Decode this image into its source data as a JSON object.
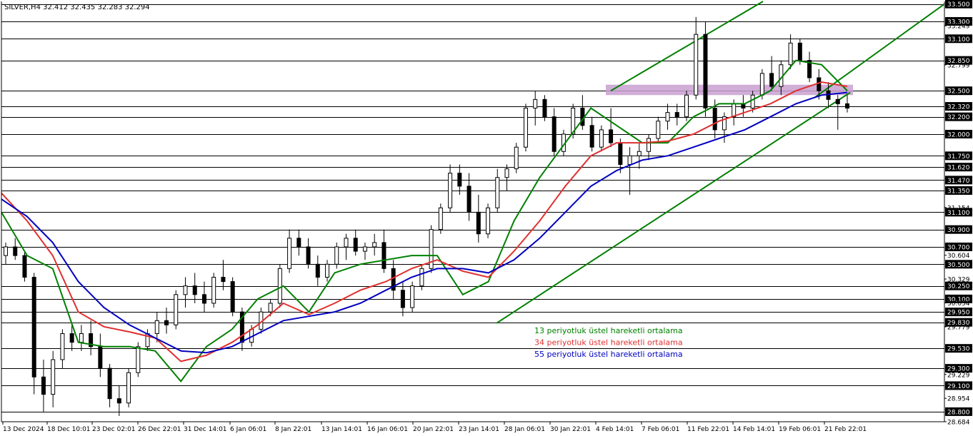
{
  "chart_data": {
    "type": "candlestick",
    "symbol_header": "SILVER,H4  32.412 32.435 32.283 32.294",
    "ylim": [
      28.684,
      33.53
    ],
    "level_lines": [
      33.5,
      33.3,
      33.1,
      32.85,
      32.5,
      32.32,
      32.2,
      32.0,
      31.75,
      31.62,
      31.47,
      31.35,
      31.1,
      30.9,
      30.7,
      30.5,
      30.25,
      30.1,
      29.95,
      29.83,
      29.53,
      29.3,
      29.1,
      28.8
    ],
    "y_tick_labels_boxed": [
      "33.500",
      "33.300",
      "33.100",
      "32.850",
      "32.500",
      "32.320",
      "32.200",
      "32.000",
      "31.750",
      "31.620",
      "31.470",
      "31.350",
      "31.100",
      "30.900",
      "30.700",
      "30.500",
      "30.250",
      "30.100",
      "29.950",
      "29.830",
      "29.530",
      "29.300",
      "29.100",
      "28.800"
    ],
    "y_tick_labels_plain": [
      {
        "value": 33.249,
        "text": "33.249"
      },
      {
        "value": 32.799,
        "text": "32.799"
      },
      {
        "value": 31.154,
        "text": "31.154"
      },
      {
        "value": 30.604,
        "text": "30.604"
      },
      {
        "value": 30.329,
        "text": "30.329"
      },
      {
        "value": 30.054,
        "text": "30.054"
      },
      {
        "value": 29.779,
        "text": "29.779"
      },
      {
        "value": 29.229,
        "text": "29.229"
      },
      {
        "value": 28.954,
        "text": "28.954"
      },
      {
        "value": 28.684,
        "text": "28.684"
      }
    ],
    "x_tick_labels": [
      "13 Dec 2024",
      "18 Dec 10:01",
      "23 Dec 02:01",
      "26 Dec 22:01",
      "31 Dec 14:01",
      "6 Jan 06:01",
      "8 Jan 22:01",
      "13 Jan 14:01",
      "16 Jan 06:01",
      "20 Jan 22:01",
      "23 Jan 14:01",
      "28 Jan 06:01",
      "30 Jan 22:01",
      "4 Feb 14:01",
      "7 Feb 06:01",
      "11 Feb 22:01",
      "14 Feb 14:01",
      "19 Feb 06:01",
      "21 Feb 22:01"
    ],
    "ema_series": [
      {
        "name": "13 periyotluk üstel hareketli ortalama",
        "color": "#008000",
        "values": [
          31.1,
          30.6,
          30.45,
          29.6,
          29.55,
          29.55,
          29.5,
          29.15,
          29.55,
          29.75,
          30.1,
          30.25,
          29.95,
          30.4,
          30.5,
          30.55,
          30.6,
          30.6,
          30.15,
          30.3,
          31.0,
          31.5,
          31.9,
          32.3,
          32.1,
          31.9,
          31.9,
          32.2,
          32.35,
          32.35,
          32.5,
          32.85,
          32.8,
          32.5
        ]
      },
      {
        "name": "34 periyotluk üstel hareketli ortalama",
        "color": "#e03030",
        "values": [
          31.32,
          31.0,
          30.6,
          29.95,
          29.78,
          29.72,
          29.65,
          29.38,
          29.45,
          29.6,
          29.8,
          30.05,
          29.92,
          30.05,
          30.2,
          30.3,
          30.45,
          30.55,
          30.42,
          30.35,
          30.65,
          31.0,
          31.4,
          31.75,
          31.9,
          31.9,
          31.92,
          32.0,
          32.15,
          32.25,
          32.35,
          32.5,
          32.6,
          32.55
        ]
      },
      {
        "name": "55 periyotluk üstel hareketli ortalama",
        "color": "#0000c0",
        "values": [
          31.25,
          31.05,
          30.75,
          30.3,
          30.0,
          29.8,
          29.65,
          29.5,
          29.48,
          29.55,
          29.7,
          29.85,
          29.9,
          29.95,
          30.05,
          30.2,
          30.35,
          30.45,
          30.45,
          30.4,
          30.55,
          30.8,
          31.1,
          31.4,
          31.58,
          31.7,
          31.75,
          31.85,
          31.95,
          32.05,
          32.2,
          32.35,
          32.45,
          32.48
        ]
      }
    ],
    "candles": [
      [
        30.6,
        30.75,
        30.5,
        30.7
      ],
      [
        30.7,
        30.8,
        30.55,
        30.6
      ],
      [
        30.6,
        30.65,
        30.3,
        30.35
      ],
      [
        30.35,
        30.4,
        29.0,
        29.2
      ],
      [
        29.2,
        29.4,
        28.8,
        29.0
      ],
      [
        29.0,
        29.5,
        28.85,
        29.4
      ],
      [
        29.4,
        29.75,
        29.3,
        29.7
      ],
      [
        29.7,
        29.8,
        29.5,
        29.6
      ],
      [
        29.6,
        29.8,
        29.5,
        29.7
      ],
      [
        29.7,
        29.85,
        29.45,
        29.55
      ],
      [
        29.55,
        29.7,
        29.2,
        29.3
      ],
      [
        29.3,
        29.35,
        28.85,
        28.95
      ],
      [
        28.95,
        29.1,
        28.75,
        28.9
      ],
      [
        28.9,
        29.3,
        28.85,
        29.25
      ],
      [
        29.25,
        29.6,
        29.2,
        29.55
      ],
      [
        29.55,
        29.75,
        29.5,
        29.7
      ],
      [
        29.7,
        29.95,
        29.6,
        29.85
      ],
      [
        29.85,
        30.0,
        29.7,
        29.8
      ],
      [
        29.8,
        30.2,
        29.75,
        30.15
      ],
      [
        30.15,
        30.35,
        30.0,
        30.25
      ],
      [
        30.25,
        30.4,
        30.05,
        30.15
      ],
      [
        30.15,
        30.3,
        29.95,
        30.05
      ],
      [
        30.05,
        30.4,
        30.0,
        30.35
      ],
      [
        30.35,
        30.55,
        30.2,
        30.3
      ],
      [
        30.3,
        30.35,
        29.9,
        29.95
      ],
      [
        29.95,
        30.0,
        29.5,
        29.6
      ],
      [
        29.6,
        29.8,
        29.55,
        29.75
      ],
      [
        29.75,
        30.0,
        29.7,
        29.95
      ],
      [
        29.95,
        30.1,
        29.9,
        30.05
      ],
      [
        30.05,
        30.5,
        30.0,
        30.45
      ],
      [
        30.45,
        30.9,
        30.4,
        30.8
      ],
      [
        30.8,
        30.9,
        30.6,
        30.7
      ],
      [
        30.7,
        30.8,
        30.45,
        30.5
      ],
      [
        30.5,
        30.6,
        30.25,
        30.35
      ],
      [
        30.35,
        30.55,
        30.3,
        30.5
      ],
      [
        30.5,
        30.75,
        30.45,
        30.7
      ],
      [
        30.7,
        30.85,
        30.55,
        30.8
      ],
      [
        30.8,
        30.9,
        30.6,
        30.65
      ],
      [
        30.65,
        30.75,
        30.55,
        30.7
      ],
      [
        30.7,
        30.85,
        30.6,
        30.75
      ],
      [
        30.75,
        30.9,
        30.4,
        30.45
      ],
      [
        30.45,
        30.55,
        30.1,
        30.2
      ],
      [
        30.2,
        30.3,
        29.9,
        30.0
      ],
      [
        30.0,
        30.3,
        29.95,
        30.25
      ],
      [
        30.25,
        30.5,
        30.2,
        30.45
      ],
      [
        30.45,
        30.95,
        30.4,
        30.9
      ],
      [
        30.9,
        31.2,
        30.85,
        31.15
      ],
      [
        31.15,
        31.65,
        31.1,
        31.55
      ],
      [
        31.55,
        31.65,
        31.3,
        31.4
      ],
      [
        31.4,
        31.55,
        31.0,
        31.1
      ],
      [
        31.1,
        31.3,
        30.75,
        30.85
      ],
      [
        30.85,
        31.2,
        30.8,
        31.15
      ],
      [
        31.15,
        31.6,
        31.1,
        31.5
      ],
      [
        31.5,
        31.65,
        31.35,
        31.6
      ],
      [
        31.6,
        31.9,
        31.55,
        31.85
      ],
      [
        31.85,
        32.35,
        31.8,
        32.3
      ],
      [
        32.3,
        32.5,
        32.1,
        32.4
      ],
      [
        32.4,
        32.45,
        32.15,
        32.2
      ],
      [
        32.2,
        32.3,
        31.75,
        31.8
      ],
      [
        31.8,
        32.05,
        31.75,
        32.0
      ],
      [
        32.0,
        32.35,
        31.95,
        32.3
      ],
      [
        32.3,
        32.45,
        32.05,
        32.1
      ],
      [
        32.1,
        32.2,
        31.8,
        31.85
      ],
      [
        31.85,
        32.1,
        31.8,
        32.05
      ],
      [
        32.05,
        32.3,
        31.85,
        31.9
      ],
      [
        31.9,
        31.95,
        31.55,
        31.65
      ],
      [
        31.65,
        31.85,
        31.3,
        31.75
      ],
      [
        31.75,
        31.9,
        31.6,
        31.8
      ],
      [
        31.8,
        32.0,
        31.7,
        31.95
      ],
      [
        31.95,
        32.2,
        31.9,
        32.15
      ],
      [
        32.15,
        32.35,
        32.05,
        32.25
      ],
      [
        32.25,
        32.35,
        32.1,
        32.2
      ],
      [
        32.2,
        32.5,
        32.15,
        32.45
      ],
      [
        32.45,
        33.35,
        32.4,
        33.15
      ],
      [
        33.15,
        33.3,
        32.2,
        32.3
      ],
      [
        32.3,
        32.4,
        31.95,
        32.05
      ],
      [
        32.05,
        32.25,
        31.9,
        32.2
      ],
      [
        32.2,
        32.4,
        32.1,
        32.35
      ],
      [
        32.35,
        32.45,
        32.2,
        32.3
      ],
      [
        32.3,
        32.5,
        32.25,
        32.45
      ],
      [
        32.45,
        32.75,
        32.4,
        32.7
      ],
      [
        32.7,
        32.9,
        32.5,
        32.55
      ],
      [
        32.55,
        32.85,
        32.45,
        32.8
      ],
      [
        32.8,
        33.15,
        32.75,
        33.05
      ],
      [
        33.05,
        33.1,
        32.8,
        32.85
      ],
      [
        32.85,
        32.95,
        32.6,
        32.65
      ],
      [
        32.65,
        32.75,
        32.4,
        32.5
      ],
      [
        32.5,
        32.6,
        32.3,
        32.4
      ],
      [
        32.4,
        32.45,
        32.05,
        32.35
      ],
      [
        32.35,
        32.45,
        32.25,
        32.3
      ]
    ],
    "channel_lines": [
      {
        "from": [
          0.0,
          29.8
        ],
        "to": [
          1.0,
          32.9
        ],
        "color": "#008000"
      },
      {
        "from": [
          0.0,
          32.5
        ],
        "to": [
          1.0,
          33.53
        ],
        "color": "#008000"
      },
      {
        "from": [
          0.0,
          32.4
        ],
        "to": [
          1.0,
          33.5
        ],
        "color": "#008000"
      }
    ],
    "resistance_zone": {
      "low": 32.45,
      "high": 32.57,
      "color": "#c8a0d0"
    },
    "grid": false,
    "legend_placement": "bottom-center"
  }
}
